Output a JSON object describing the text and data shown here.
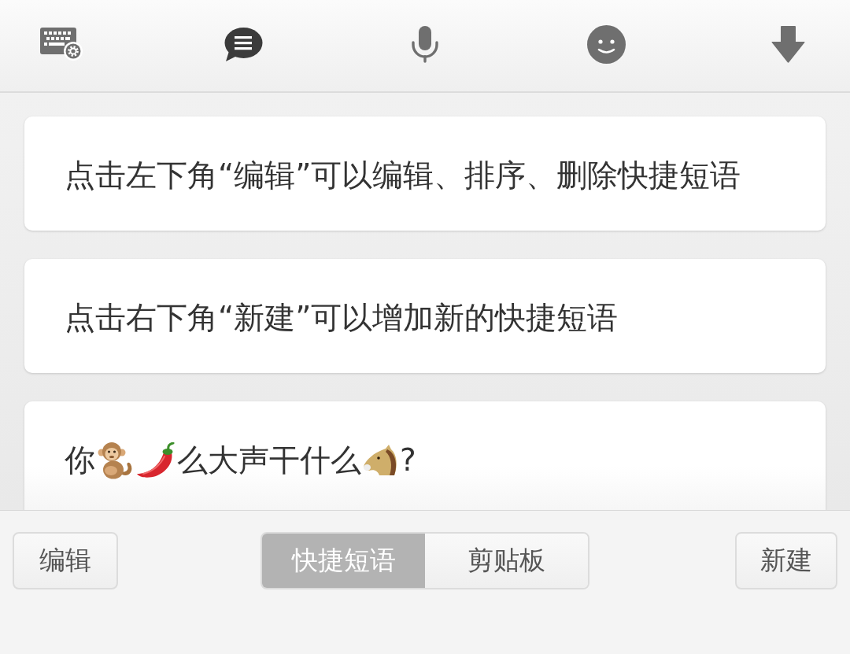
{
  "toolbar": {
    "icons": [
      {
        "kind": "keyboard",
        "selected": false
      },
      {
        "kind": "chat",
        "selected": true
      },
      {
        "kind": "mic",
        "selected": false
      },
      {
        "kind": "smiley",
        "selected": false
      },
      {
        "kind": "hide",
        "selected": false
      }
    ]
  },
  "phrases": [
    {
      "parts": [
        {
          "kind": "text",
          "text": "点击左下角“编辑”可以编辑、排序、删除快捷短语"
        }
      ]
    },
    {
      "parts": [
        {
          "kind": "text",
          "text": "点击右下角“新建”可以增加新的快捷短语"
        }
      ]
    },
    {
      "parts": [
        {
          "kind": "text",
          "text": "你"
        },
        {
          "kind": "monkey"
        },
        {
          "kind": "pepper"
        },
        {
          "kind": "text",
          "text": "么大声干什么"
        },
        {
          "kind": "horse"
        },
        {
          "kind": "text",
          "text": "?"
        }
      ]
    }
  ],
  "bottom_bar": {
    "edit_button": "编辑",
    "tabs": [
      {
        "label": "快捷短语",
        "selected": true
      },
      {
        "label": "剪贴板",
        "selected": false
      }
    ],
    "new_button": "新建"
  }
}
